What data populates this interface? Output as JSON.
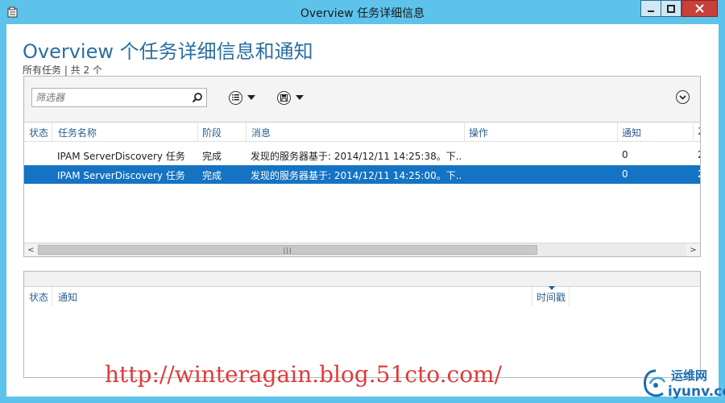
{
  "window": {
    "title": "Overview 任务详细信息",
    "controls": {
      "minimize": "—",
      "maximize": "□",
      "close": "✕"
    }
  },
  "page": {
    "heading": "Overview 个任务详细信息和通知",
    "subheading": "所有任务 | 共 2 个"
  },
  "toolbar": {
    "filter_placeholder": "筛选器",
    "icons": [
      "search-icon",
      "list-view-icon",
      "save-icon",
      "expand-icon"
    ]
  },
  "tasks_table": {
    "columns": [
      "状态",
      "任务名称",
      "阶段",
      "消息",
      "操作",
      "通知",
      "2"
    ],
    "rows": [
      {
        "status": "",
        "name": "IPAM ServerDiscovery 任务",
        "phase": "完成",
        "message": "发现的服务器基于: 2014/12/11 14:25:38。下...",
        "action": "",
        "notify": "0",
        "extra": "2",
        "selected": false
      },
      {
        "status": "",
        "name": "IPAM ServerDiscovery 任务",
        "phase": "完成",
        "message": "发现的服务器基于: 2014/12/11 14:25:00。下...",
        "action": "",
        "notify": "0",
        "extra": "2",
        "selected": true
      }
    ],
    "scrollbar": {
      "left_arrow": "<",
      "right_arrow": ">",
      "grip": "|||"
    }
  },
  "notifications_table": {
    "columns": [
      "状态",
      "通知",
      "时间戳"
    ]
  },
  "overlay": {
    "watermark": "http://winteragain.blog.51cto.com/",
    "logo_cn": "运维网",
    "logo_en": "iyunv.com"
  },
  "colors": {
    "accent": "#2a6fa0",
    "selection": "#1473c3",
    "frame": "#5ec3eb",
    "watermark": "#e03a3a"
  }
}
